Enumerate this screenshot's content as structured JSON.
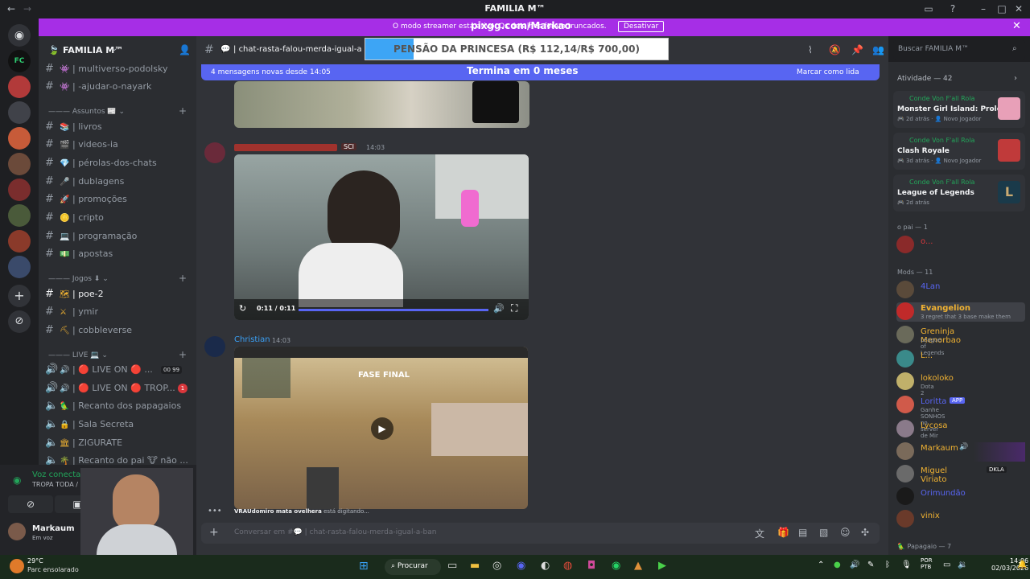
{
  "window": {
    "title": "FAMILIA M™"
  },
  "streamer": {
    "message": "O modo streamer está ativo. Os detalhes foram truncados.",
    "button": "Desativar",
    "overlay": "pixgg.com/Markao"
  },
  "goal": {
    "text": "PENSÃO DA PRINCESA (R$ 112,14/R$ 700,00)",
    "ends": "Termina em 0 meses",
    "progress": 0.16
  },
  "server": {
    "name": "FAMILIA M™"
  },
  "sidebar": {
    "channels": [
      {
        "name": "multiverso-podolsky",
        "emoji": "👾"
      },
      {
        "name": "-ajudar-o-nayark",
        "emoji": "👾"
      }
    ],
    "cat_assuntos": "Assuntos 📰",
    "assuntos": [
      {
        "name": "livros"
      },
      {
        "name": "videos-ia"
      },
      {
        "name": "pérolas-dos-chats"
      },
      {
        "name": "dublagens"
      },
      {
        "name": "promoções"
      },
      {
        "name": "cripto"
      },
      {
        "name": "programação"
      },
      {
        "name": "apostas"
      }
    ],
    "cat_jogos": "Jogos ⬇",
    "jogos": [
      {
        "name": "poe-2"
      },
      {
        "name": "ymir"
      },
      {
        "name": "cobbleverse"
      }
    ],
    "cat_live": "LIVE 💻",
    "live": [
      {
        "name": "🔴 LIVE ON 🔴 ...",
        "badge1": "00",
        "badge2": "99"
      },
      {
        "name": "🔴 LIVE ON 🔴 TROP...",
        "badge": "1"
      },
      {
        "name": "Recanto dos papagaios"
      },
      {
        "name": "Sala Secreta"
      },
      {
        "name": "ZIGURATE"
      },
      {
        "name": "Recanto do pai 🐮 não ..."
      }
    ]
  },
  "overlay_numbers": [
    "1",
    "0",
    "0"
  ],
  "voice": {
    "status": "Voz conectada",
    "channel": "TROPA TODA / Servidor d..."
  },
  "user": {
    "name": "Markaum",
    "status": "Em voz"
  },
  "channel": {
    "name": "chat-rasta-falou-merda-igual-a-b"
  },
  "newbar": {
    "text": "4 mensagens novas desde 14:05",
    "mark": "Marcar como lida"
  },
  "messages": [
    {
      "author": "",
      "tag": "SCI",
      "time": "14:03",
      "video_time": "0:11 / 0:11"
    },
    {
      "author": "Christian",
      "time": "14:03",
      "overlay": "FASE FINAL"
    }
  ],
  "typing": {
    "who": "VRAUdomiro mata ovelhera",
    "text": "está digitando..."
  },
  "input": {
    "placeholder": "Conversar em #💬 | chat-rasta-falou-merda-igual-a-ban"
  },
  "search": {
    "placeholder": "Buscar FAMILIA M™"
  },
  "activity": {
    "header": "Atividade — 42",
    "cards": [
      {
        "user": "Conde Von F'all Rola",
        "game": "Monster Girl Island: Prolog...",
        "time": "2d atrás",
        "tag": "Novo Jogador"
      },
      {
        "user": "Conde Von F'all Rola",
        "game": "Clash Royale",
        "time": "3d atrás",
        "tag": "Novo Jogador"
      },
      {
        "user": "Conde Von F'all Rola",
        "game": "League of Legends",
        "time": "2d atrás",
        "tag": ""
      }
    ]
  },
  "members": {
    "group_pai": "o pai — 1",
    "pai": [
      {
        "name": "o..."
      }
    ],
    "group_mods": "Mods — 11",
    "mods": [
      {
        "name": "4Lan",
        "color": "#5865f2",
        "sub": ""
      },
      {
        "name": "Evangelion",
        "color": "#f0b232",
        "sub": "3 regret that 3 base make them"
      },
      {
        "name": "Greninja Menorbao",
        "color": "#f0b232",
        "sub": "League of Legends"
      },
      {
        "name": "L...",
        "color": "#f0b232",
        "sub": ""
      },
      {
        "name": "lokoloko",
        "color": "#f0b232",
        "sub": "Dota 2"
      },
      {
        "name": "Loritta",
        "color": "#5865f2",
        "sub": "Ganhe SONHOS no server de Mir",
        "badge": "APP"
      },
      {
        "name": "Lycosa",
        "color": "#f0b232",
        "sub": ""
      },
      {
        "name": "Markaum",
        "color": "#f0b232",
        "sub": ""
      },
      {
        "name": "Miguel Viriato",
        "color": "#f0b232",
        "sub": "",
        "badge": "DKLA"
      },
      {
        "name": "Orimundão",
        "color": "#5865f2",
        "sub": ""
      },
      {
        "name": "vinix",
        "color": "#f0b232",
        "sub": ""
      }
    ],
    "group_pap": "Papagaio — 7"
  },
  "taskbar": {
    "weather": "29°C",
    "weather_desc": "Parc ensolarado",
    "search": "Procurar",
    "lang": "POR",
    "lang2": "PTB",
    "time": "14:06",
    "date": "02/03/2026"
  }
}
